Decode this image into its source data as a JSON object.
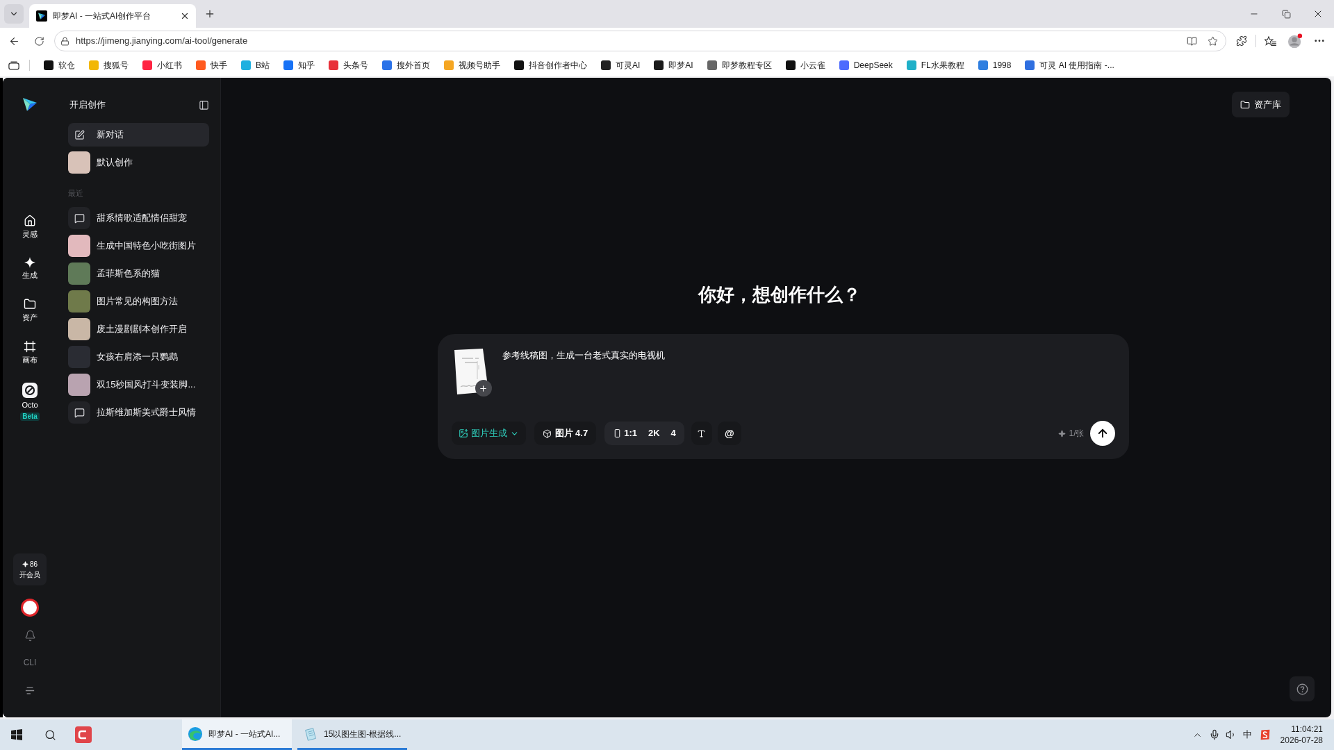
{
  "browser": {
    "tabs": [
      {
        "title": "即梦AI - 一站式AI创作平台",
        "selected": true
      }
    ],
    "url": "https://jimeng.jianying.com/ai-tool/generate",
    "bookmarks": [
      {
        "label": "软仓",
        "color": "#111111"
      },
      {
        "label": "搜狐号",
        "color": "#f2b705"
      },
      {
        "label": "小红书",
        "color": "#ff2442"
      },
      {
        "label": "快手",
        "color": "#ff5a1f"
      },
      {
        "label": "B站",
        "color": "#1fb0e0"
      },
      {
        "label": "知乎",
        "color": "#1772f6"
      },
      {
        "label": "头条号",
        "color": "#e8303a"
      },
      {
        "label": "搜外首页",
        "color": "#2a72e8"
      },
      {
        "label": "视频号助手",
        "color": "#f5a623"
      },
      {
        "label": "抖音创作者中心",
        "color": "#111111"
      },
      {
        "label": "可灵AI",
        "color": "#222222"
      },
      {
        "label": "即梦AI",
        "color": "#1a1a1a"
      },
      {
        "label": "即梦教程专区",
        "color": "#666666"
      },
      {
        "label": "小云雀",
        "color": "#111111"
      },
      {
        "label": "DeepSeek",
        "color": "#4d6bfe"
      },
      {
        "label": "FL水果教程",
        "color": "#1fb0c8"
      },
      {
        "label": "1998",
        "color": "#2f7fe0"
      },
      {
        "label": "可灵 AI 使用指南 -...",
        "color": "#2f6fe0"
      }
    ]
  },
  "app": {
    "rail": {
      "items": [
        {
          "label": "灵感"
        },
        {
          "label": "生成"
        },
        {
          "label": "资产"
        },
        {
          "label": "画布"
        },
        {
          "label": "Octo",
          "badge": "Beta"
        }
      ],
      "credits": "86",
      "membership": "开会员",
      "cli": "CLI"
    },
    "sidebar": {
      "title": "开启创作",
      "items": [
        {
          "label": "新对话",
          "kind": "new",
          "selected": true
        },
        {
          "label": "默认创作",
          "kind": "image",
          "selected": false
        }
      ],
      "recent_heading": "最近",
      "recent": [
        {
          "label": "甜系情歌适配情侣甜宠",
          "kind": "chat",
          "selected": false
        },
        {
          "label": "生成中国特色小吃街图片",
          "kind": "image",
          "selected": false
        },
        {
          "label": "孟菲斯色系的猫",
          "kind": "image",
          "selected": false
        },
        {
          "label": "图片常见的构图方法",
          "kind": "image",
          "selected": false
        },
        {
          "label": "废土漫剧剧本创作开启",
          "kind": "image",
          "selected": false
        },
        {
          "label": "女孩右肩添一只鹦鹉",
          "kind": "image",
          "selected": false
        },
        {
          "label": "双15秒国风打斗变装脚...",
          "kind": "image",
          "selected": false
        },
        {
          "label": "拉斯维加斯美式爵士风情",
          "kind": "chat",
          "selected": false
        }
      ]
    },
    "main": {
      "assets_button": "资产库",
      "greeting": "你好，想创作什么？",
      "composer": {
        "prompt": "参考线稿图，生成一台老式真实的电视机",
        "mode": "图片生成",
        "model": "图片 4.7",
        "aspect": "1:1",
        "resolution": "2K",
        "count": "4",
        "mention": "@",
        "cost": "1/张"
      }
    }
  },
  "taskbar": {
    "items": [
      {
        "label": "即梦AI - 一站式AI...",
        "selected": true
      },
      {
        "label": "15以图生图-根据线...",
        "selected": false
      }
    ],
    "ime": "中",
    "time": "11:04:21",
    "date": "2026-07-28"
  }
}
